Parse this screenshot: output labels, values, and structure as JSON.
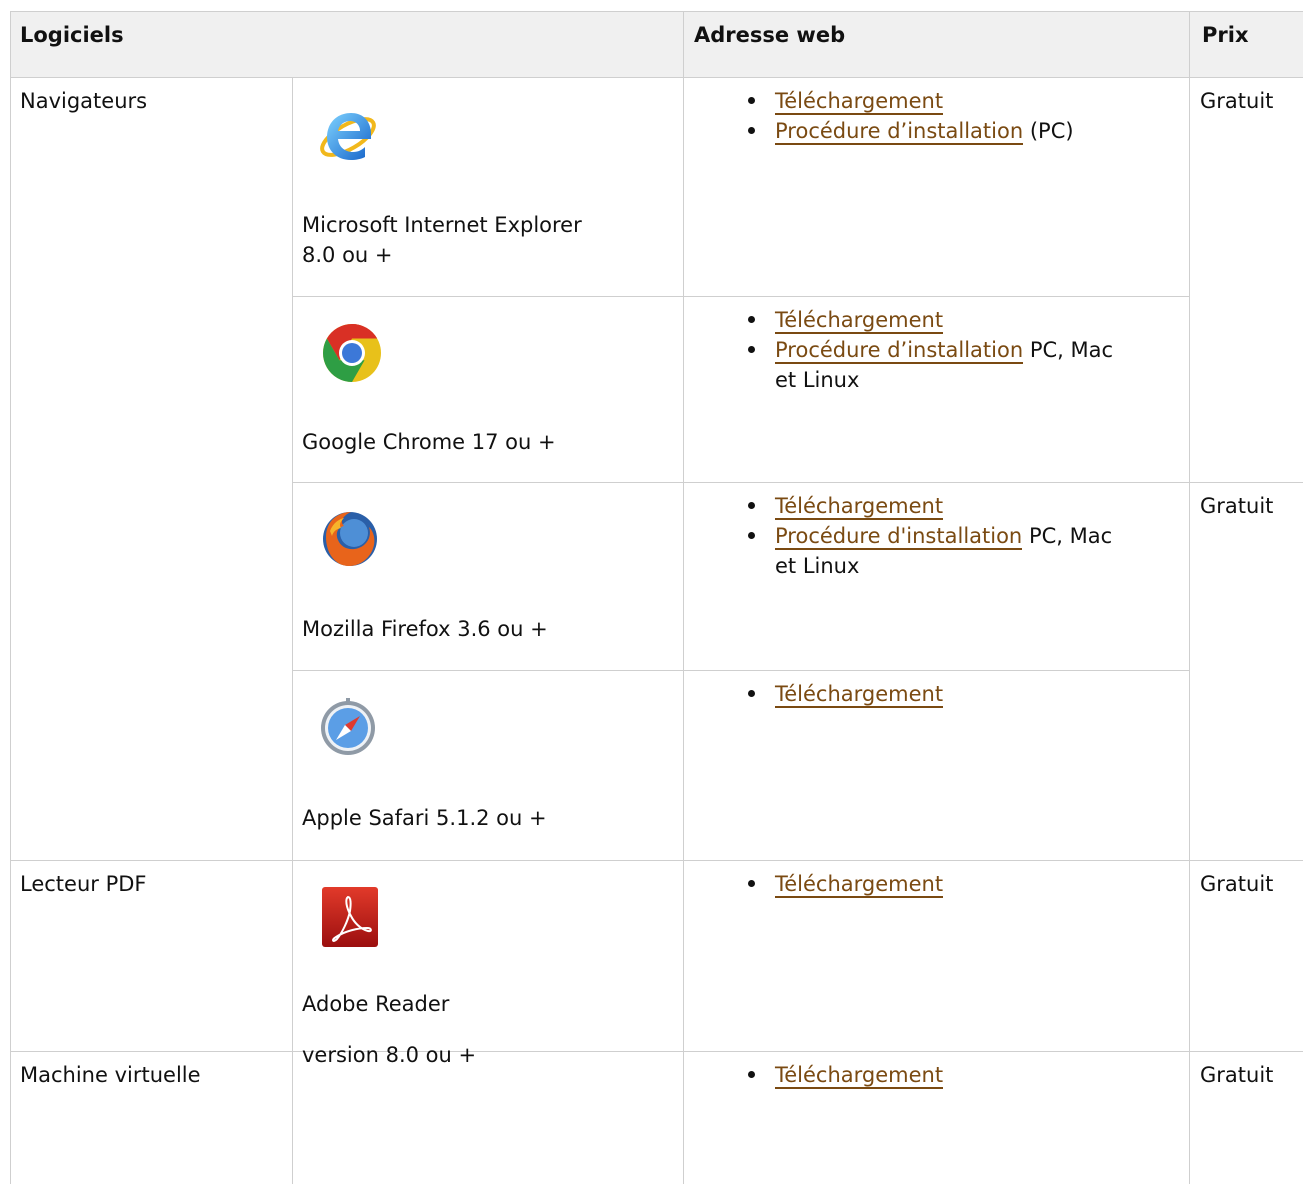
{
  "table": {
    "headers": {
      "software": "Logiciels",
      "web_address": "Adresse web",
      "price": "Prix"
    },
    "rows": [
      {
        "category": "Navigateurs",
        "icon": "internet-explorer-icon",
        "name_line1": "Microsoft Internet Explorer",
        "name_line2": "8.0 ou +",
        "links": [
          {
            "label": "Téléchargement",
            "suffix": ""
          },
          {
            "label": "Procédure d’installation",
            "suffix": "(PC)"
          }
        ],
        "price": "Gratuit"
      },
      {
        "category": "",
        "icon": "google-chrome-icon",
        "name_line1": "Google Chrome 17 ou +",
        "name_line2": "",
        "links": [
          {
            "label": "Téléchargement",
            "suffix": ""
          },
          {
            "label": "Procédure d’installation",
            "suffix": "PC, Mac",
            "suffix_line2": "et Linux"
          }
        ],
        "price": ""
      },
      {
        "category": "",
        "icon": "mozilla-firefox-icon",
        "name_line1": " Mozilla Firefox 3.6 ou +",
        "name_line2": "",
        "links": [
          {
            "label": "Téléchargement",
            "suffix": ""
          },
          {
            "label": "Procédure d'installation",
            "suffix": "PC, Mac",
            "suffix_line2": "et Linux"
          }
        ],
        "price": "Gratuit"
      },
      {
        "category": "",
        "icon": "apple-safari-icon",
        "name_line1": "Apple Safari 5.1.2 ou +",
        "name_line2": "",
        "links": [
          {
            "label": "Téléchargement",
            "suffix": ""
          }
        ],
        "price": ""
      },
      {
        "category": "Lecteur PDF",
        "icon": "adobe-reader-icon",
        "name_line1": "Adobe Reader",
        "name_line2": "version 8.0 ou +",
        "links": [
          {
            "label": "Téléchargement",
            "suffix": ""
          }
        ],
        "price": "Gratuit"
      },
      {
        "category": "Machine virtuelle",
        "icon": "",
        "name_line1": "",
        "name_line2": "",
        "links": [
          {
            "label": "Téléchargement",
            "suffix": ""
          }
        ],
        "price": "Gratuit"
      }
    ]
  },
  "colors": {
    "link": "#7a4a12",
    "header_bg": "#f0f0f0",
    "border": "#cfcfcf"
  }
}
